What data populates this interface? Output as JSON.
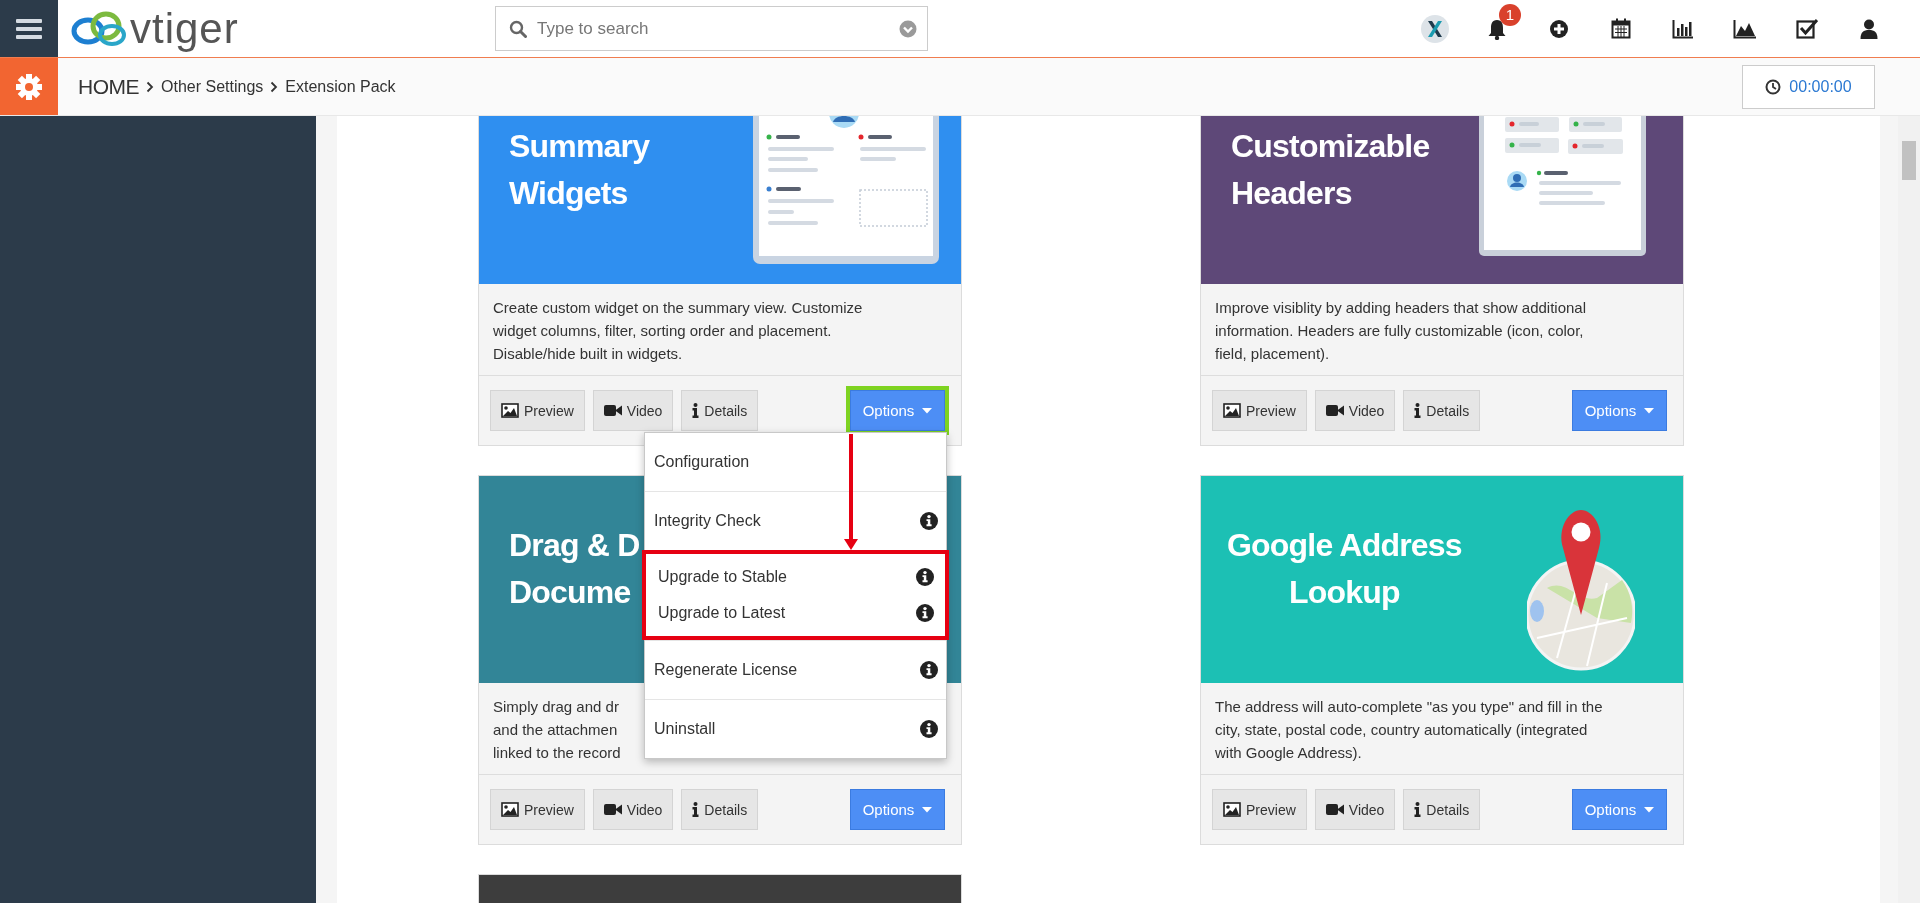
{
  "top_bar": {
    "logo": "vtiger",
    "search": {
      "placeholder": "Type to search"
    },
    "icons": [
      {
        "kind": "app"
      },
      {
        "kind": "notifications",
        "badge": "1"
      },
      {
        "kind": "add"
      },
      {
        "kind": "calendar"
      },
      {
        "kind": "bar-chart"
      },
      {
        "kind": "area-chart"
      },
      {
        "kind": "tasks"
      },
      {
        "kind": "user"
      }
    ]
  },
  "breadcrumb": [
    {
      "label": "HOME",
      "kind": "home"
    },
    {
      "label": "Other Settings",
      "kind": "link"
    },
    {
      "label": "Extension Pack",
      "kind": "current"
    }
  ],
  "timer": "00:00:00",
  "cards": [
    {
      "color": "#2f8ff0",
      "kind": "widgets",
      "title_lines": [
        "Summary",
        "Widgets"
      ],
      "description_lines": [
        "Create custom widget on the summary view. Customize",
        "widget columns, filter, sorting order and placement.",
        "Disable/hide built in widgets."
      ],
      "buttons": [
        {
          "kind": "preview",
          "label": "Preview"
        },
        {
          "kind": "video",
          "label": "Video"
        },
        {
          "kind": "details",
          "label": "Details"
        }
      ],
      "options": {
        "label": "Options",
        "highlighted": true,
        "menu": [
          {
            "highlighted": false,
            "items": [
              {
                "label": "Configuration",
                "info": false
              }
            ]
          },
          {
            "highlighted": false,
            "items": [
              {
                "label": "Integrity Check",
                "info": true
              }
            ]
          },
          {
            "highlighted": true,
            "items": [
              {
                "label": "Upgrade to Stable",
                "info": true
              },
              {
                "label": "Upgrade to Latest",
                "info": true
              }
            ]
          },
          {
            "highlighted": false,
            "items": [
              {
                "label": "Regenerate License",
                "info": true
              }
            ]
          },
          {
            "highlighted": false,
            "items": [
              {
                "label": "Uninstall",
                "info": true
              }
            ]
          }
        ]
      }
    },
    {
      "color": "#5e4878",
      "kind": "headers",
      "title_lines": [
        "Customizable",
        "Headers"
      ],
      "description_lines": [
        "Improve visiblity by adding headers that show additional",
        "information. Headers are fully customizable (icon, color,",
        "field, placement)."
      ],
      "buttons": [
        {
          "kind": "preview",
          "label": "Preview"
        },
        {
          "kind": "video",
          "label": "Video"
        },
        {
          "kind": "details",
          "label": "Details"
        }
      ],
      "options": {
        "label": "Options",
        "highlighted": false
      }
    },
    {
      "color": "#328597",
      "title_lines": [
        "Drag & D",
        "Docume"
      ],
      "description_lines": [
        "Simply drag and dr",
        "and the attachmen",
        "linked to the record"
      ],
      "buttons": [
        {
          "kind": "preview",
          "label": "Preview"
        },
        {
          "kind": "video",
          "label": "Video"
        },
        {
          "kind": "details",
          "label": "Details"
        }
      ],
      "options": {
        "label": "Options",
        "highlighted": false
      }
    },
    {
      "color": "#1cc0b4",
      "kind": "map",
      "title_lines": [
        "Google Address",
        "Lookup"
      ],
      "description_lines": [
        "The address will auto-complete \"as you type\" and fill in the",
        "city, state, postal code, country automatically (integrated",
        "with Google Address)."
      ],
      "buttons": [
        {
          "kind": "preview",
          "label": "Preview"
        },
        {
          "kind": "video",
          "label": "Video"
        },
        {
          "kind": "details",
          "label": "Details"
        }
      ],
      "options": {
        "label": "Options",
        "highlighted": false
      }
    },
    {
      "color": "#3d3d3d"
    }
  ]
}
